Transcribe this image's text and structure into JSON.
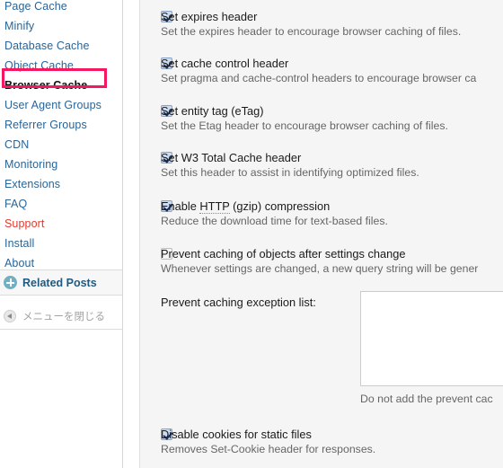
{
  "sidebar": {
    "nav_items": [
      {
        "label": "Page Cache",
        "state": "link"
      },
      {
        "label": "Minify",
        "state": "link"
      },
      {
        "label": "Database Cache",
        "state": "link"
      },
      {
        "label": "Object Cache",
        "state": "link"
      },
      {
        "label": "Browser Cache",
        "state": "current-highlighted"
      },
      {
        "label": "User Agent Groups",
        "state": "link"
      },
      {
        "label": "Referrer Groups",
        "state": "link"
      },
      {
        "label": "CDN",
        "state": "link"
      },
      {
        "label": "Monitoring",
        "state": "link"
      },
      {
        "label": "Extensions",
        "state": "link"
      },
      {
        "label": "FAQ",
        "state": "link"
      },
      {
        "label": "Support",
        "state": "alert-link"
      },
      {
        "label": "Install",
        "state": "link"
      },
      {
        "label": "About",
        "state": "link"
      }
    ],
    "related_posts": {
      "label": "Related Posts",
      "icon": "plus-circle-icon"
    },
    "collapse_menu": {
      "label": "メニューを閉じる",
      "icon": "triangle-left-icon"
    },
    "highlight_color": "#f5175f",
    "link_color": "#2a6496",
    "alert_color": "#e23a2e"
  },
  "content": {
    "options": [
      {
        "title": "Set expires header",
        "description": "Set the expires header to encourage browser caching of files.",
        "checked": true
      },
      {
        "title": "Set cache control header",
        "description": "Set pragma and cache-control headers to encourage browser ca",
        "checked": true
      },
      {
        "title_prefix": "Set entity tag (eTag)",
        "title": "Set entity tag (eTag)",
        "description": "Set the Etag header to encourage browser caching of files.",
        "checked": true
      },
      {
        "title": "Set W3 Total Cache header",
        "description": "Set this header to assist in identifying optimized files.",
        "checked": true
      },
      {
        "title_before": "Enable ",
        "title_abbr": "HTTP",
        "title_after": " (gzip) compression",
        "description": "Reduce the download time for text-based files.",
        "checked": true
      },
      {
        "title": "Prevent caching of objects after settings change",
        "description": "Whenever settings are changed, a new query string will be gener",
        "checked": false
      },
      {
        "title": "Disable cookies for static files",
        "description": "Removes Set-Cookie header for responses.",
        "checked": true
      }
    ],
    "exception_list": {
      "label": "Prevent caching exception list:",
      "value": "",
      "note": "Do not add the prevent cac"
    }
  }
}
